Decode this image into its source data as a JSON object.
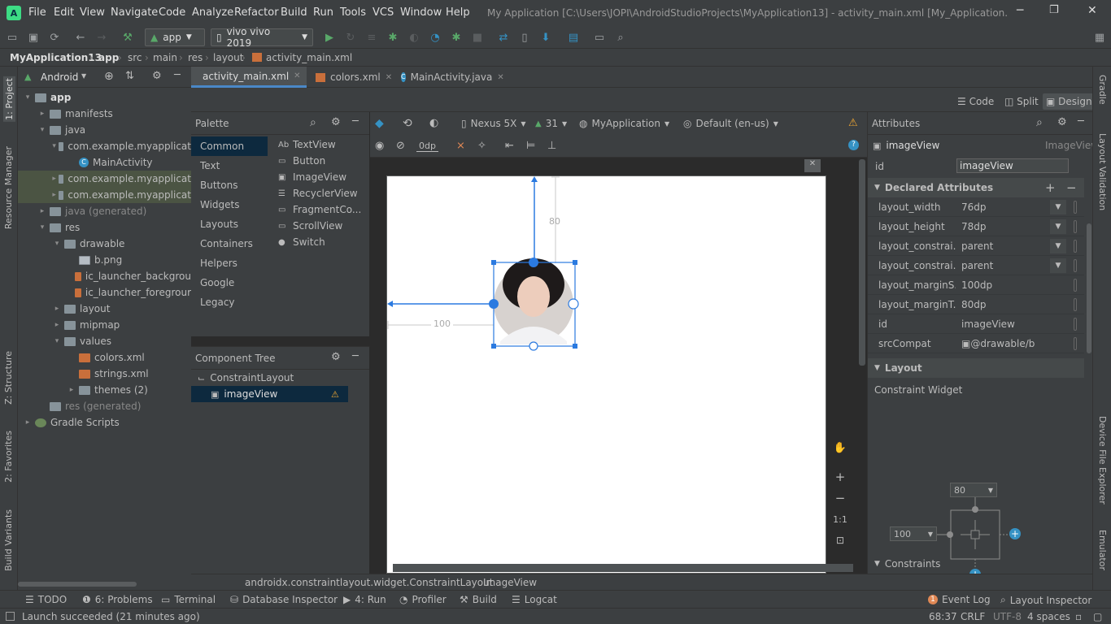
{
  "menu": [
    "File",
    "Edit",
    "View",
    "Navigate",
    "Code",
    "Analyze",
    "Refactor",
    "Build",
    "Run",
    "Tools",
    "VCS",
    "Window",
    "Help"
  ],
  "window_title": "My Application [C:\\Users\\JOPI\\AndroidStudioProjects\\MyApplication13] - activity_main.xml [My_Application.app]",
  "toolbar": {
    "config": "app",
    "device": "vivo vivo 2019"
  },
  "breadcrumb": [
    "MyApplication13",
    "app",
    "src",
    "main",
    "res",
    "layout",
    "activity_main.xml"
  ],
  "left_strip": [
    "1: Project",
    "Resource Manager",
    "Z: Structure",
    "2: Favorites",
    "Build Variants"
  ],
  "right_strip": [
    "Gradle",
    "Layout Validation",
    "Device File Explorer",
    "Emulator"
  ],
  "project": {
    "view": "Android",
    "tree": [
      {
        "label": "app",
        "depth": 0,
        "arrow": "▾",
        "icon": "folder",
        "bold": true
      },
      {
        "label": "manifests",
        "depth": 1,
        "arrow": "▸",
        "icon": "folder"
      },
      {
        "label": "java",
        "depth": 1,
        "arrow": "▾",
        "icon": "folder"
      },
      {
        "label": "com.example.myapplicat",
        "depth": 2,
        "arrow": "▾",
        "icon": "pkg"
      },
      {
        "label": "MainActivity",
        "depth": 3,
        "arrow": "",
        "icon": "class"
      },
      {
        "label": "com.example.myapplicat",
        "depth": 2,
        "arrow": "▸",
        "icon": "pkg",
        "selected": true
      },
      {
        "label": "com.example.myapplicat",
        "depth": 2,
        "arrow": "▸",
        "icon": "pkg",
        "selected": true
      },
      {
        "label": "java (generated)",
        "depth": 1,
        "arrow": "▸",
        "icon": "folder",
        "dim": true
      },
      {
        "label": "res",
        "depth": 1,
        "arrow": "▾",
        "icon": "folder"
      },
      {
        "label": "drawable",
        "depth": 2,
        "arrow": "▾",
        "icon": "folder"
      },
      {
        "label": "b.png",
        "depth": 3,
        "arrow": "",
        "icon": "image"
      },
      {
        "label": "ic_launcher_backgrou",
        "depth": 3,
        "arrow": "",
        "icon": "xml"
      },
      {
        "label": "ic_launcher_foregrour",
        "depth": 3,
        "arrow": "",
        "icon": "xml"
      },
      {
        "label": "layout",
        "depth": 2,
        "arrow": "▸",
        "icon": "folder"
      },
      {
        "label": "mipmap",
        "depth": 2,
        "arrow": "▸",
        "icon": "folder"
      },
      {
        "label": "values",
        "depth": 2,
        "arrow": "▾",
        "icon": "folder"
      },
      {
        "label": "colors.xml",
        "depth": 3,
        "arrow": "",
        "icon": "xml"
      },
      {
        "label": "strings.xml",
        "depth": 3,
        "arrow": "",
        "icon": "xml"
      },
      {
        "label": "themes (2)",
        "depth": 3,
        "arrow": "▸",
        "icon": "folder"
      },
      {
        "label": "res (generated)",
        "depth": 1,
        "arrow": "",
        "icon": "folder",
        "dim": true
      },
      {
        "label": "Gradle Scripts",
        "depth": 0,
        "arrow": "▸",
        "icon": "gradle"
      }
    ]
  },
  "tabs": [
    "activity_main.xml",
    "colors.xml",
    "MainActivity.java"
  ],
  "view_modes": [
    "Code",
    "Split",
    "Design"
  ],
  "palette": {
    "title": "Palette",
    "categories": [
      "Common",
      "Text",
      "Buttons",
      "Widgets",
      "Layouts",
      "Containers",
      "Helpers",
      "Google",
      "Legacy"
    ],
    "items": [
      {
        "icon": "Ab",
        "label": "TextView"
      },
      {
        "icon": "▭",
        "label": "Button"
      },
      {
        "icon": "▣",
        "label": "ImageView"
      },
      {
        "icon": "☰",
        "label": "RecyclerView"
      },
      {
        "icon": "▭",
        "label": "FragmentCo..."
      },
      {
        "icon": "▭",
        "label": "ScrollView"
      },
      {
        "icon": "●",
        "label": "Switch"
      }
    ]
  },
  "component_tree": {
    "title": "Component Tree",
    "root": "ConstraintLayout",
    "child": "imageView"
  },
  "design_toolbar": {
    "device": "Nexus 5X",
    "api": "31",
    "theme": "MyApplication",
    "locale": "Default (en-us)",
    "margin": "0dp"
  },
  "canvas": {
    "top_margin_label": "80",
    "left_margin_label": "100"
  },
  "attributes": {
    "title": "Attributes",
    "component": "imageView",
    "component_type": "ImageView",
    "id_label": "id",
    "id_value": "imageView",
    "declared_title": "Declared Attributes",
    "declared": [
      {
        "name": "layout_width",
        "value": "76dp",
        "dropdown": true
      },
      {
        "name": "layout_height",
        "value": "78dp",
        "dropdown": true
      },
      {
        "name": "layout_constrai...",
        "value": "parent",
        "dropdown": true
      },
      {
        "name": "layout_constrai...",
        "value": "parent",
        "dropdown": true
      },
      {
        "name": "layout_marginS...",
        "value": "100dp",
        "dropdown": false
      },
      {
        "name": "layout_marginT...",
        "value": "80dp",
        "dropdown": false
      },
      {
        "name": "id",
        "value": "imageView",
        "dropdown": false
      },
      {
        "name": "srcCompat",
        "value": "@drawable/b",
        "dropdown": false
      }
    ],
    "layout_title": "Layout",
    "constraint_widget": "Constraint Widget",
    "top_margin": "80",
    "left_margin": "100",
    "constraints_title": "Constraints"
  },
  "editor_breadcrumb": [
    "androidx.constraintlayout.widget.ConstraintLayout",
    "ImageView"
  ],
  "bottom_tools": [
    "TODO",
    "6: Problems",
    "Terminal",
    "Database Inspector",
    "4: Run",
    "Profiler",
    "Build",
    "Logcat"
  ],
  "bottom_right": [
    "Event Log",
    "Layout Inspector"
  ],
  "event_count": "1",
  "status": {
    "message": "Launch succeeded (21 minutes ago)",
    "position": "68:37",
    "line_sep": "CRLF",
    "encoding": "UTF-8",
    "indent": "4 spaces"
  }
}
